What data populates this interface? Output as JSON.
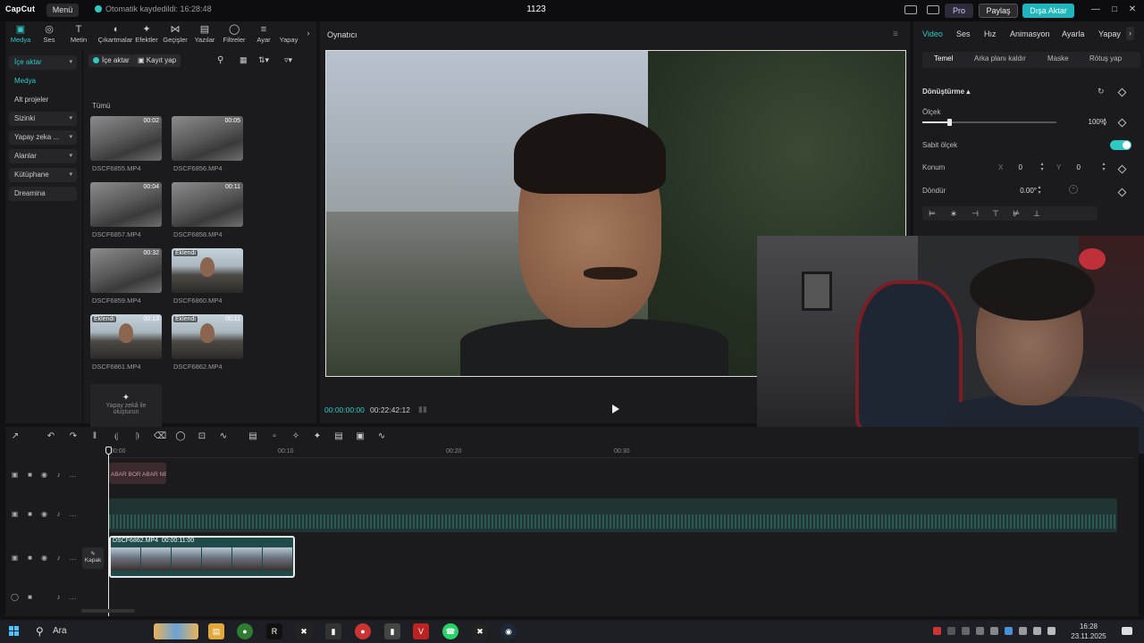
{
  "titlebar": {
    "app_logo": "CapCut",
    "menu_label": "Menü",
    "autosave_text": "Otomatik kaydedildi: 16:28:48",
    "project_title": "1123",
    "pro_label": "Pro",
    "share_label": "Paylaş",
    "export_label": "Dışa Aktar"
  },
  "tool_tabs": [
    {
      "label": "Medya",
      "icon": "media-icon"
    },
    {
      "label": "Ses",
      "icon": "audio-icon"
    },
    {
      "label": "Metin",
      "icon": "text-icon"
    },
    {
      "label": "Çıkartmalar",
      "icon": "sticker-icon"
    },
    {
      "label": "Efektler",
      "icon": "effects-icon"
    },
    {
      "label": "Geçişler",
      "icon": "transitions-icon"
    },
    {
      "label": "Yazılar",
      "icon": "captions-icon"
    },
    {
      "label": "Filtreler",
      "icon": "filters-icon"
    },
    {
      "label": "Ayar",
      "icon": "adjust-icon"
    },
    {
      "label": "Yapay",
      "icon": "ai-icon"
    }
  ],
  "sidebar": {
    "items": [
      {
        "label": "İçe aktar",
        "chevron": true
      },
      {
        "label": "Medya",
        "chevron": false
      },
      {
        "label": "Alt projeler",
        "chevron": false
      },
      {
        "label": "Sizinki",
        "chevron": true
      },
      {
        "label": "Yapay zeka ...",
        "chevron": true
      },
      {
        "label": "Alanlar",
        "chevron": true
      },
      {
        "label": "Kütüphane",
        "chevron": true
      },
      {
        "label": "Dreamina",
        "chevron": false
      }
    ]
  },
  "media": {
    "import_label": "İçe aktar",
    "record_label": "Kayıt yap",
    "all_label": "Tümü",
    "clips": [
      {
        "name": "DSCF6855.MP4",
        "duration": "00:02",
        "added": "",
        "style": "gray"
      },
      {
        "name": "DSCF6856.MP4",
        "duration": "00:05",
        "added": "",
        "style": "gray"
      },
      {
        "name": "DSCF6857.MP4",
        "duration": "00:04",
        "added": "",
        "style": "gray"
      },
      {
        "name": "DSCF6858.MP4",
        "duration": "00:11",
        "added": "",
        "style": "gray"
      },
      {
        "name": "DSCF6859.MP4",
        "duration": "00:32",
        "added": "",
        "style": "gray"
      },
      {
        "name": "DSCF6860.MP4",
        "duration": "",
        "added": "Eklendi",
        "style": "face"
      },
      {
        "name": "DSCF6861.MP4",
        "duration": "00:13",
        "added": "Eklendi",
        "style": "face"
      },
      {
        "name": "DSCF6862.MP4",
        "duration": "00:11",
        "added": "Eklendi",
        "style": "face"
      }
    ],
    "ai_card_line1": "Yapay zekâ ile",
    "ai_card_line2": "oluşturun"
  },
  "player": {
    "title": "Oynatıcı",
    "current_time": "00:00:00:00",
    "total_time": "00:22:42:12"
  },
  "inspector": {
    "tabs": [
      "Video",
      "Ses",
      "Hız",
      "Animasyon",
      "Ayarla",
      "Yapay"
    ],
    "subtabs": [
      "Temel",
      "Arka planı kaldır",
      "Maske",
      "Rötuş yap"
    ],
    "section_title": "Dönüştürme",
    "scale_label": "Ölçek",
    "scale_value": "100%",
    "scale_level": 0.2,
    "uniform_scale_label": "Sabit ölçek",
    "uniform_scale_on": true,
    "position_label": "Konum",
    "x_label": "X",
    "x_value": "0",
    "y_label": "Y",
    "y_value": "0",
    "rotate_label": "Döndür",
    "rotate_value": "0.00°"
  },
  "timeline": {
    "ruler": [
      "00:00",
      "00:10",
      "00:20",
      "00:30"
    ],
    "text_clip": "ABAR BOR ABAR NE",
    "main_clip_name": "DSCF6862.MP4",
    "main_clip_duration": "00:00:11:00",
    "cover_label": "Kapak"
  },
  "taskbar": {
    "search_label": "Ara",
    "time": "16:28",
    "date": "23.11.2025"
  },
  "colors": {
    "accent": "#2ec9c3",
    "background": "#121214",
    "panel": "#1b1b1e"
  }
}
